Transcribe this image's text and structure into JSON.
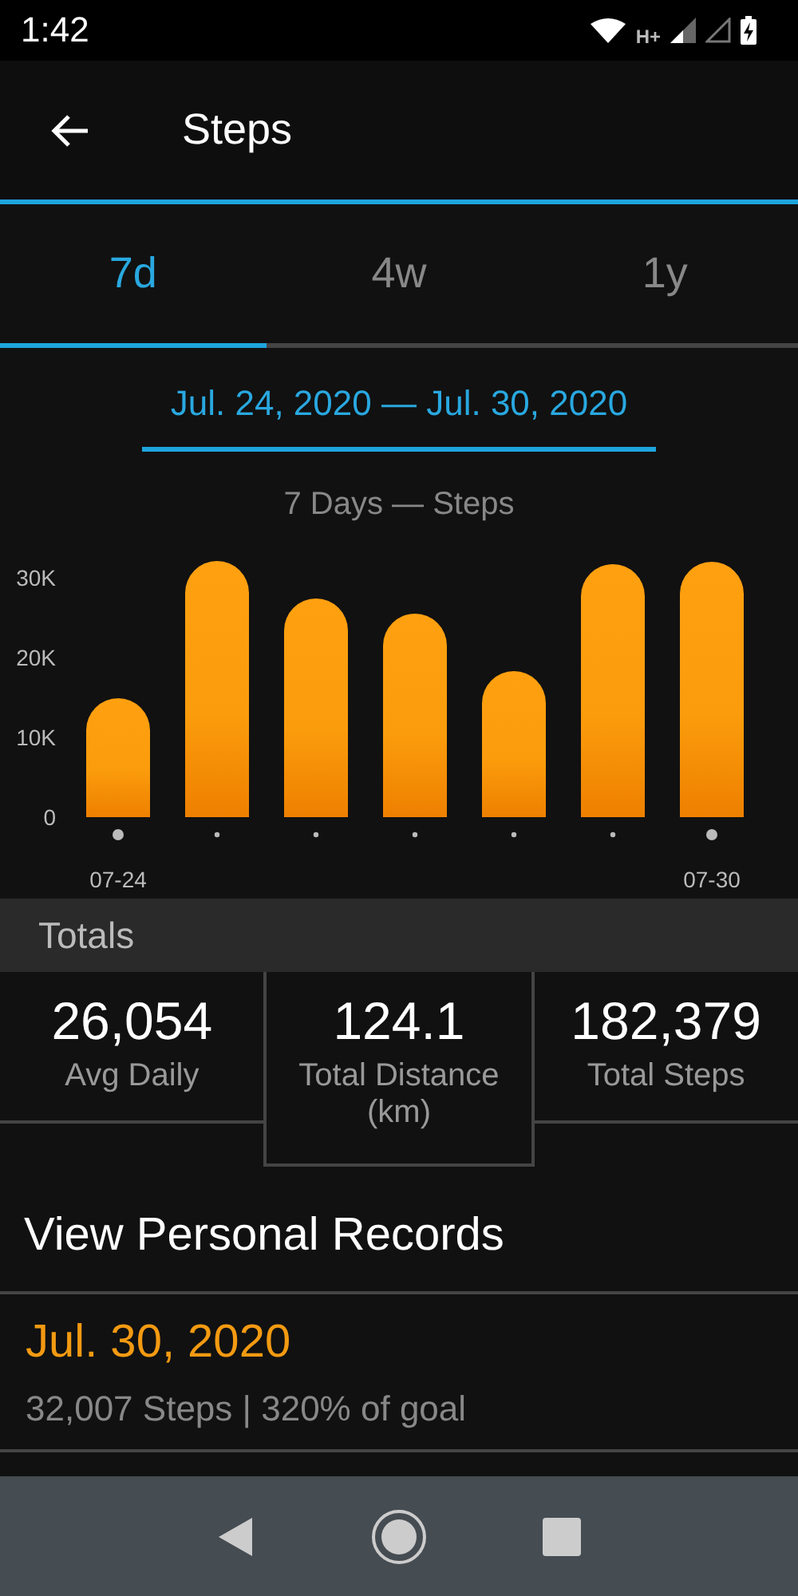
{
  "status_bar": {
    "time": "1:42",
    "network": "H+"
  },
  "app_bar": {
    "title": "Steps"
  },
  "tabs": [
    {
      "label": "7d",
      "selected": true
    },
    {
      "label": "4w",
      "selected": false
    },
    {
      "label": "1y",
      "selected": false
    }
  ],
  "date_range": "Jul. 24, 2020 — Jul. 30, 2020",
  "chart": {
    "chart_data": {
      "type": "bar",
      "title": "7 Days — Steps",
      "values": [
        14900,
        32100,
        27400,
        25500,
        18300,
        31700,
        32000
      ],
      "ylim": [
        0,
        32500
      ],
      "categories": [
        "07-24",
        null,
        null,
        null,
        null,
        null,
        "07-30"
      ],
      "yticks": [
        {
          "value": 0,
          "label": "0"
        },
        {
          "value": 10000,
          "label": "10K"
        },
        {
          "value": 20000,
          "label": "20K"
        },
        {
          "value": 30000,
          "label": "30K"
        }
      ]
    }
  },
  "totals": {
    "heading": "Totals",
    "stats": [
      {
        "value": "26,054",
        "label": "Avg Daily",
        "selected": false
      },
      {
        "value": "124.1",
        "label": "Total Distance (km)",
        "selected": true
      },
      {
        "value": "182,379",
        "label": "Total Steps",
        "selected": false
      }
    ]
  },
  "records": {
    "link": "View Personal Records",
    "items": [
      {
        "date": "Jul. 30, 2020",
        "detail": "32,007 Steps | 320% of goal"
      }
    ]
  }
}
